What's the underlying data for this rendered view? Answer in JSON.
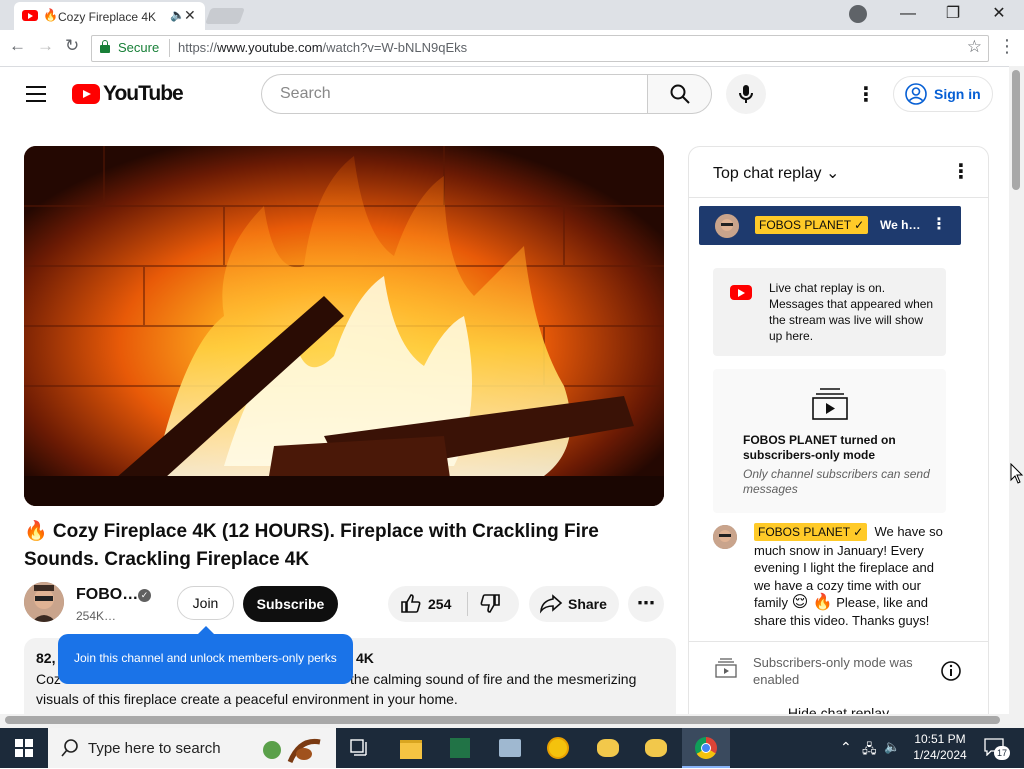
{
  "browser": {
    "tab_title": "Cozy Fireplace 4K",
    "tab_emoji": "🔥",
    "secure_label": "Secure",
    "url_scheme": "https://",
    "url_domain": "www.youtube.com",
    "url_path": "/watch?v=W-bNLN9qEks"
  },
  "header": {
    "logo_text": "YouTube",
    "search_placeholder": "Search",
    "signin_label": "Sign in"
  },
  "video": {
    "title": "🔥 Cozy Fireplace 4K (12 HOURS). Fireplace with Crackling Fire Sounds. Crackling Fireplace 4K",
    "channel_name": "FOBO…",
    "subscribers": "254K…",
    "join_label": "Join",
    "subscribe_label": "Subscribe",
    "like_count": "254",
    "share_label": "Share",
    "desc_meta_left": "82,",
    "desc_meta_right": "4K",
    "desc_line1_left": "Coz",
    "desc_line1_right": "the calming sound of fire and the mesmerizing",
    "desc_line2": "visuals of this fireplace create a peaceful environment in your home.",
    "join_tooltip": "Join this channel and unlock members-only perks"
  },
  "chat": {
    "header_label": "Top chat replay",
    "pinned_badge": "FOBOS PLANET",
    "pinned_preview": "We h…",
    "replay_notice": "Live chat replay is on. Messages that appeared when the stream was live will show up here.",
    "subs_mode_title": "FOBOS PLANET turned on subscribers-only mode",
    "subs_mode_sub": "Only channel subscribers can send messages",
    "msg_badge": "FOBOS PLANET",
    "msg_text_1": "We have so much snow in January! Every evening I light the fireplace and we have a cozy time with our family",
    "msg_emojis": "😌 🔥",
    "msg_text_2": "Please, like and share this video. Thanks guys!",
    "subs_mode_enabled": "Subscribers-only mode was enabled",
    "hide_chat": "Hide chat replay"
  },
  "taskbar": {
    "search_placeholder": "Type here to search",
    "time": "10:51 PM",
    "date": "1/24/2024",
    "notification_count": "17"
  },
  "colors": {
    "youtube_red": "#ff0000",
    "link_blue": "#065fd4",
    "tooltip_blue": "#1a73e8",
    "badge_yellow": "#ffca28",
    "pinned_bg": "#1e3a6e"
  }
}
